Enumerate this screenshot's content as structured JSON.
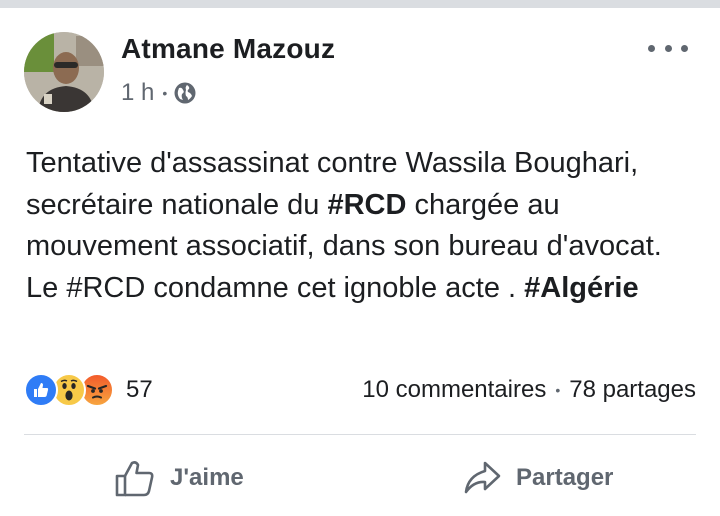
{
  "post": {
    "author": "Atmane Mazouz",
    "time": "1 h",
    "separator": "•",
    "text_parts": [
      "Tentative d'assassinat contre Wassila Boughari, secrétaire nationale du ",
      "#RCD",
      " chargée au mouvement associatif, dans son bureau d'avocat. Le #RCD condamne cet ignoble acte . ",
      "#Algérie"
    ]
  },
  "reactions": {
    "icons": [
      "like-icon",
      "wow-icon",
      "angry-icon"
    ],
    "count": "57"
  },
  "stats": {
    "comments": "10 commentaires",
    "separator": "•",
    "shares": "78 partages"
  },
  "actions": {
    "like_label": "J'aime",
    "share_label": "Partager"
  },
  "colors": {
    "text": "#1c1e21",
    "secondary": "#606770",
    "like_blue": "#2f7cf6",
    "divider": "#dadde1"
  }
}
